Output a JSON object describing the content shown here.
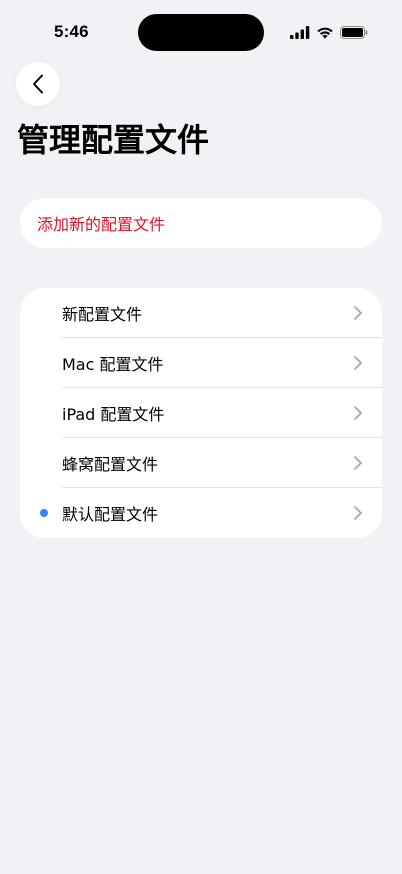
{
  "status_bar": {
    "time": "5:46"
  },
  "nav": {
    "back_icon": "chevron-left-icon"
  },
  "page": {
    "title": "管理配置文件"
  },
  "actions": {
    "add_label": "添加新的配置文件",
    "add_color": "#E0132A"
  },
  "profiles": {
    "items": [
      {
        "label": "新配置文件",
        "active": false
      },
      {
        "label": "Mac 配置文件",
        "active": false
      },
      {
        "label": "iPad 配置文件",
        "active": false
      },
      {
        "label": "蜂窝配置文件",
        "active": false
      },
      {
        "label": "默认配置文件",
        "active": true
      }
    ],
    "active_dot_color": "#3B82F6"
  }
}
